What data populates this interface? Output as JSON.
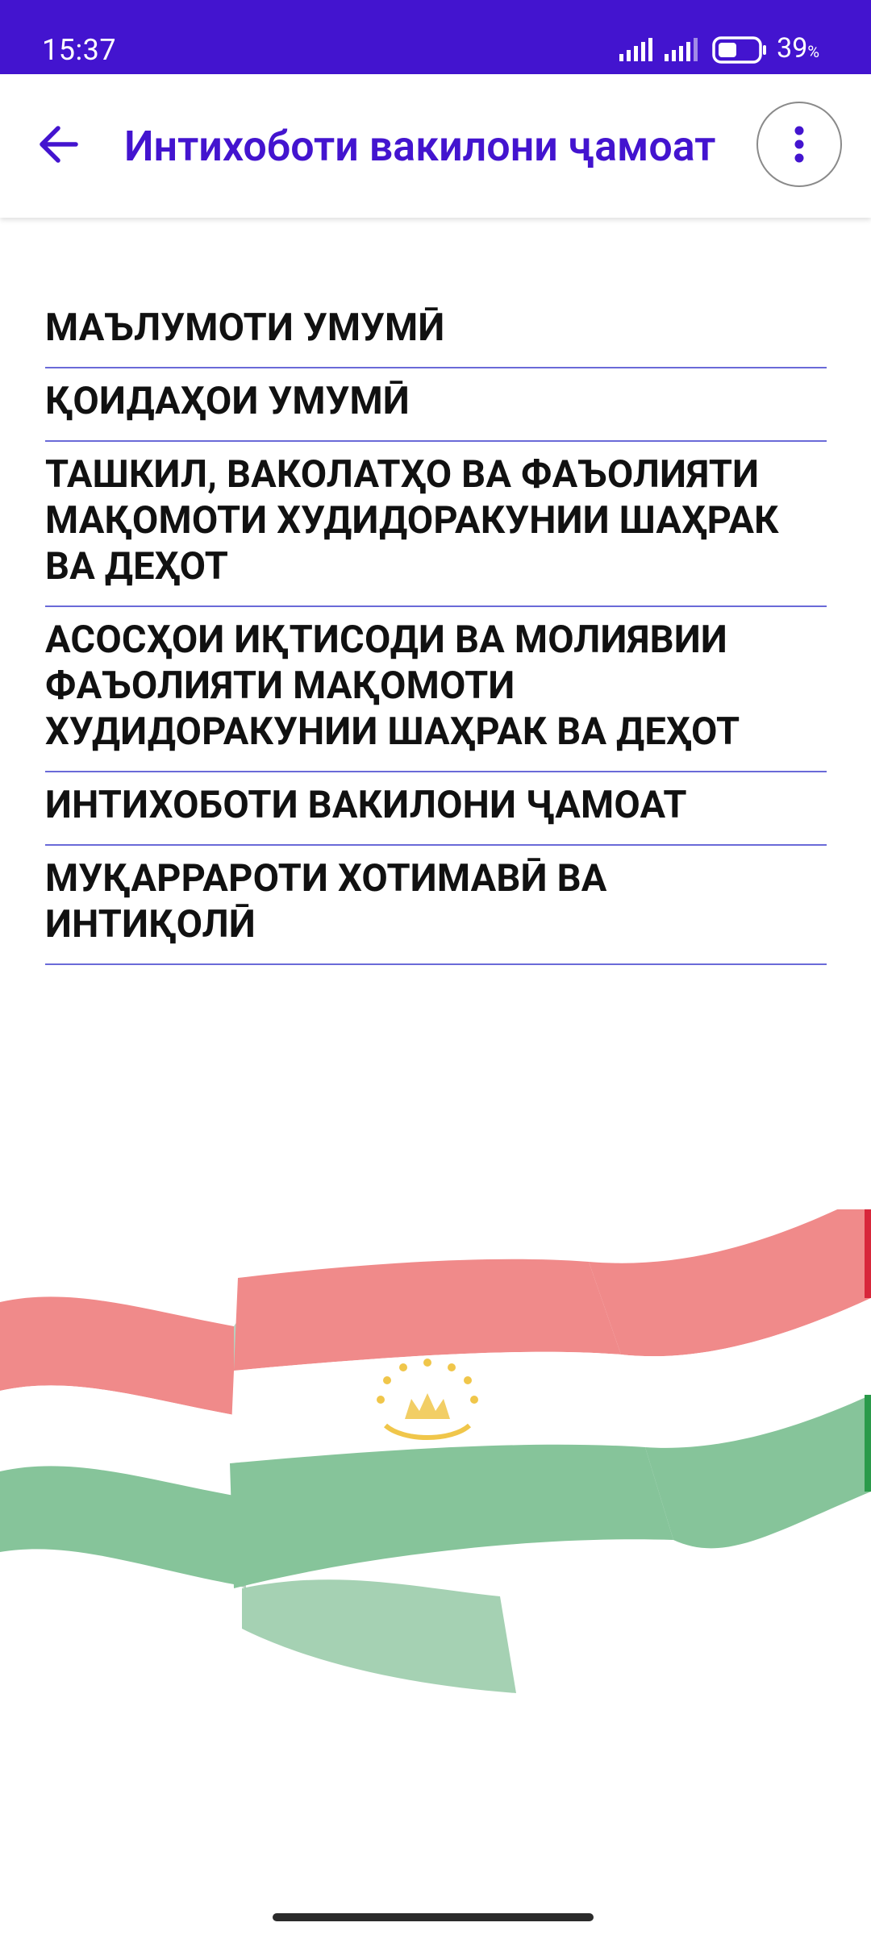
{
  "status_bar": {
    "time": "15:37",
    "battery_percent": "39",
    "battery_unit": "%",
    "background_color": "#4314cf"
  },
  "app_bar": {
    "title": "Интихоботи вакилони ҷамоат",
    "back_icon": "arrow-left-icon",
    "menu_icon": "more-vert-icon",
    "accent_color": "#4314cf"
  },
  "menu": {
    "items": [
      {
        "label": "МАЪЛУМОТИ УМУМӢ"
      },
      {
        "label": "ҚОИДАҲОИ УМУМӢ"
      },
      {
        "label": "ТАШКИЛ, ВАКОЛАТҲО ВА ФАЪОЛИЯТИ МАҚОМОТИ ХУДИДОРАКУНИИ ШАҲРАК ВА ДЕҲОТ"
      },
      {
        "label": "АСОСҲОИ ИҚТИСОДИ ВА МОЛИЯВИИ ФАЪОЛИЯТИ МАҚОМОТИ ХУДИДОРАКУНИИ ШАҲРАК ВА ДЕҲОТ"
      },
      {
        "label": "ИНТИХОБОТИ ВАКИЛОНИ ҶАМОАТ"
      },
      {
        "label": "МУҚАРРАРОТИ ХОТИМАВӢ ВА ИНТИҚОЛӢ"
      }
    ],
    "divider_color": "#6a6ad8"
  },
  "banner": {
    "image": "tajikistan-flag-waving",
    "colors": {
      "red": "#f08a8a",
      "white": "#ffffff",
      "green": "#86c49a",
      "emblem": "#f0c64a"
    }
  }
}
